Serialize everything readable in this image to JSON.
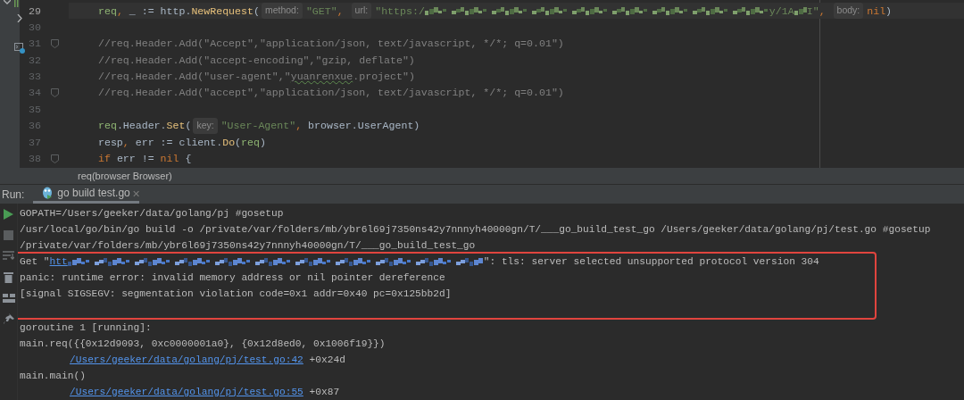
{
  "editor": {
    "lines": [
      {
        "number": "29",
        "current": true,
        "fold": false,
        "tokens": [
          {
            "text": "req",
            "kind": "var"
          },
          {
            "text": ", ",
            "kind": "kw"
          },
          {
            "text": "_ := http.",
            "kind": "plain"
          },
          {
            "text": "NewRequest",
            "kind": "func"
          },
          {
            "text": "(",
            "kind": "plain"
          },
          {
            "text": "method:",
            "kind": "hint"
          },
          {
            "text": "\"GET\"",
            "kind": "str"
          },
          {
            "text": ", ",
            "kind": "kw"
          },
          {
            "text": "url:",
            "kind": "hint"
          },
          {
            "text": "\"https:/",
            "kind": "str"
          },
          {
            "kind": "redacted"
          },
          {
            "text": "y/1A",
            "kind": "str"
          },
          {
            "kind": "redacted"
          },
          {
            "text": "I\"",
            "kind": "str"
          },
          {
            "text": ", ",
            "kind": "kw"
          },
          {
            "text": "body:",
            "kind": "hint"
          },
          {
            "text": "nil",
            "kind": "kw"
          },
          {
            "text": ")",
            "kind": "plain"
          }
        ]
      },
      {
        "number": "30",
        "current": false,
        "fold": false
      },
      {
        "number": "31",
        "current": false,
        "fold": true,
        "tokens": [
          {
            "text": "//req.Header.Add(\"Accept\",\"application/json, text/javascript, */*; q=0.01\")",
            "kind": "comment"
          }
        ]
      },
      {
        "number": "32",
        "current": false,
        "fold": false,
        "tokens": [
          {
            "text": "//req.Header.Add(\"accept-encoding\",\"gzip, deflate\")",
            "kind": "comment"
          }
        ]
      },
      {
        "number": "33",
        "current": false,
        "fold": false,
        "tokens": [
          {
            "text": "//req.Header.Add(\"user-agent\",\"",
            "kind": "comment"
          },
          {
            "text": "yuanrenxue",
            "kind": "typo"
          },
          {
            "text": ".project\")",
            "kind": "comment"
          }
        ]
      },
      {
        "number": "34",
        "current": false,
        "fold": true,
        "tokens": [
          {
            "text": "//req.Header.Add(\"accept\",\"application/json, text/javascript, */*; q=0.01\")",
            "kind": "comment"
          }
        ]
      },
      {
        "number": "35",
        "current": false,
        "fold": false
      },
      {
        "number": "36",
        "current": false,
        "fold": false,
        "tokens": [
          {
            "text": "req",
            "kind": "var"
          },
          {
            "text": ".Header.",
            "kind": "plain"
          },
          {
            "text": "Set",
            "kind": "func"
          },
          {
            "text": "(",
            "kind": "plain"
          },
          {
            "text": "key:",
            "kind": "hint"
          },
          {
            "text": "\"User-Agent\"",
            "kind": "str"
          },
          {
            "text": ", ",
            "kind": "kw"
          },
          {
            "text": "browser.UserAgent)",
            "kind": "plain"
          }
        ]
      },
      {
        "number": "37",
        "current": false,
        "fold": false,
        "tokens": [
          {
            "text": "resp",
            "kind": "plain"
          },
          {
            "text": ", ",
            "kind": "kw"
          },
          {
            "text": "err := client.",
            "kind": "plain"
          },
          {
            "text": "Do",
            "kind": "func"
          },
          {
            "text": "(",
            "kind": "plain"
          },
          {
            "text": "req",
            "kind": "var"
          },
          {
            "text": ")",
            "kind": "plain"
          }
        ]
      },
      {
        "number": "38",
        "current": false,
        "fold": true,
        "tokens": [
          {
            "text": "if",
            "kind": "kw"
          },
          {
            "text": " err != ",
            "kind": "plain"
          },
          {
            "text": "nil",
            "kind": "kw"
          },
          {
            "text": " {",
            "kind": "plain"
          }
        ]
      }
    ]
  },
  "breadcrumb": "req(browser Browser)",
  "run_panel": {
    "label": "Run:",
    "tabs": [
      {
        "label": "go build test.go",
        "close": "✕",
        "selected": true
      }
    ]
  },
  "console": {
    "lines": [
      {
        "highlighted": false,
        "indented": false,
        "segments": [
          {
            "text": "GOPATH=/Users/geeker/data/golang/pj #gosetup",
            "kind": "text"
          }
        ]
      },
      {
        "highlighted": false,
        "indented": false,
        "segments": [
          {
            "text": "/usr/local/go/bin/go build -o /private/var/folders/mb/ybr6l69j7350ns42y7nnnyh40000gn/T/___go_build_test_go /Users/geeker/data/golang/pj/test.go #gosetup",
            "kind": "text"
          }
        ]
      },
      {
        "highlighted": false,
        "indented": false,
        "segments": [
          {
            "text": "/private/var/folders/mb/ybr6l69j7350ns42y7nnnyh40000gn/T/___go_build_test_go",
            "kind": "text"
          }
        ]
      },
      {
        "highlighted": true,
        "indented": false,
        "segments": [
          {
            "text": "Get \"",
            "kind": "text"
          },
          {
            "text": "htt",
            "kind": "link"
          },
          {
            "kind": "redacted"
          },
          {
            "text": "\": tls: server selected unsupported protocol version 304",
            "kind": "text"
          }
        ]
      },
      {
        "highlighted": true,
        "indented": false,
        "segments": [
          {
            "text": "panic: runtime error: invalid memory address or nil pointer dereference",
            "kind": "text"
          }
        ]
      },
      {
        "highlighted": true,
        "indented": false,
        "segments": [
          {
            "text": "[signal SIGSEGV: segmentation violation code=0x1 addr=0x40 pc=0x125bb2d]",
            "kind": "text"
          }
        ]
      },
      {
        "highlighted": true
      },
      {
        "highlighted": false,
        "indented": false,
        "segments": [
          {
            "text": "goroutine 1 [running]:",
            "kind": "text"
          }
        ]
      },
      {
        "highlighted": false,
        "indented": false,
        "segments": [
          {
            "text": "main.req({{0x12d9093, 0xc0000001a0}, {0x12d8ed0, 0x1006f19}})",
            "kind": "text"
          }
        ]
      },
      {
        "highlighted": false,
        "indented": true,
        "segments": [
          {
            "text": "/Users/geeker/data/golang/pj/test.go:42",
            "kind": "link"
          },
          {
            "text": " +0x24d",
            "kind": "text"
          }
        ]
      },
      {
        "highlighted": false,
        "indented": false,
        "segments": [
          {
            "text": "main.main()",
            "kind": "text"
          }
        ]
      },
      {
        "highlighted": false,
        "indented": true,
        "segments": [
          {
            "text": "/Users/geeker/data/golang/pj/test.go:55",
            "kind": "link"
          },
          {
            "text": " +0x87",
            "kind": "text"
          }
        ]
      }
    ]
  }
}
